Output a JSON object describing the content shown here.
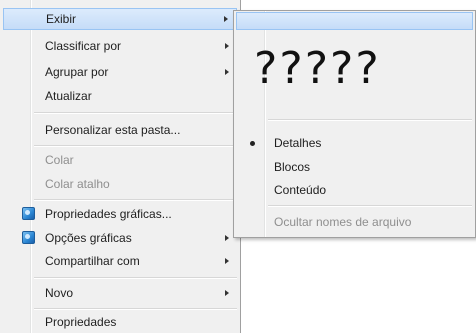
{
  "main_menu": {
    "items": [
      {
        "label": "Exibir",
        "enabled": true,
        "highlighted": true,
        "submenu": true
      },
      {
        "label": "Classificar por",
        "enabled": true,
        "submenu": true
      },
      {
        "label": "Agrupar por",
        "enabled": true,
        "submenu": true
      },
      {
        "label": "Atualizar",
        "enabled": true,
        "submenu": false
      },
      {
        "label": "Personalizar esta pasta...",
        "enabled": true,
        "submenu": false
      },
      {
        "label": "Colar",
        "enabled": false,
        "submenu": false
      },
      {
        "label": "Colar atalho",
        "enabled": false,
        "submenu": false
      },
      {
        "label": "Propriedades gráficas...",
        "enabled": true,
        "submenu": false,
        "icon": "graphics-properties-icon"
      },
      {
        "label": "Opções gráficas",
        "enabled": true,
        "submenu": true,
        "icon": "graphics-options-icon"
      },
      {
        "label": "Compartilhar com",
        "enabled": true,
        "submenu": true
      },
      {
        "label": "Novo",
        "enabled": true,
        "submenu": true
      },
      {
        "label": "Propriedades",
        "enabled": true,
        "submenu": false
      }
    ]
  },
  "sub_menu": {
    "title": "?????",
    "items": [
      {
        "label": "Detalhes",
        "enabled": true,
        "selected": true
      },
      {
        "label": "Blocos",
        "enabled": true,
        "selected": false
      },
      {
        "label": "Conteúdo",
        "enabled": true,
        "selected": false
      },
      {
        "label": "Ocultar nomes de arquivo",
        "enabled": false,
        "selected": false
      }
    ]
  },
  "colors": {
    "menu_background": "#f0f0f0",
    "highlight": "#c5dcf8",
    "highlight_border": "#99c4f3",
    "disabled_text": "#8f8f8f"
  }
}
